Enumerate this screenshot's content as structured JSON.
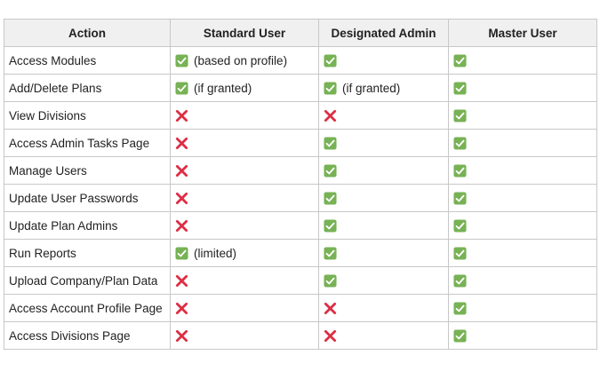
{
  "colors": {
    "header_bg": "#f0f0f0",
    "border": "#c8c8c8",
    "check_bg": "#77b255",
    "cross": "#dd2e44"
  },
  "icons": {
    "yes": "check-mark-button-icon",
    "no": "cross-mark-icon"
  },
  "table": {
    "headers": [
      "Action",
      "Standard User",
      "Designated Admin",
      "Master User"
    ],
    "rows": [
      {
        "action": "Access Modules",
        "cells": [
          {
            "mark": "yes",
            "note": "(based on profile)"
          },
          {
            "mark": "yes",
            "note": ""
          },
          {
            "mark": "yes",
            "note": ""
          }
        ]
      },
      {
        "action": "Add/Delete Plans",
        "cells": [
          {
            "mark": "yes",
            "note": "(if granted)"
          },
          {
            "mark": "yes",
            "note": "(if granted)"
          },
          {
            "mark": "yes",
            "note": ""
          }
        ]
      },
      {
        "action": "View Divisions",
        "cells": [
          {
            "mark": "no",
            "note": ""
          },
          {
            "mark": "no",
            "note": ""
          },
          {
            "mark": "yes",
            "note": ""
          }
        ]
      },
      {
        "action": "Access Admin Tasks Page",
        "cells": [
          {
            "mark": "no",
            "note": ""
          },
          {
            "mark": "yes",
            "note": ""
          },
          {
            "mark": "yes",
            "note": ""
          }
        ]
      },
      {
        "action": "Manage Users",
        "cells": [
          {
            "mark": "no",
            "note": ""
          },
          {
            "mark": "yes",
            "note": ""
          },
          {
            "mark": "yes",
            "note": ""
          }
        ]
      },
      {
        "action": "Update User Passwords",
        "cells": [
          {
            "mark": "no",
            "note": ""
          },
          {
            "mark": "yes",
            "note": ""
          },
          {
            "mark": "yes",
            "note": ""
          }
        ]
      },
      {
        "action": "Update Plan Admins",
        "cells": [
          {
            "mark": "no",
            "note": ""
          },
          {
            "mark": "yes",
            "note": ""
          },
          {
            "mark": "yes",
            "note": ""
          }
        ]
      },
      {
        "action": "Run Reports",
        "cells": [
          {
            "mark": "yes",
            "note": "(limited)"
          },
          {
            "mark": "yes",
            "note": ""
          },
          {
            "mark": "yes",
            "note": ""
          }
        ]
      },
      {
        "action": "Upload Company/Plan Data",
        "cells": [
          {
            "mark": "no",
            "note": ""
          },
          {
            "mark": "yes",
            "note": ""
          },
          {
            "mark": "yes",
            "note": ""
          }
        ]
      },
      {
        "action": "Access Account Profile Page",
        "cells": [
          {
            "mark": "no",
            "note": ""
          },
          {
            "mark": "no",
            "note": ""
          },
          {
            "mark": "yes",
            "note": ""
          }
        ]
      },
      {
        "action": "Access Divisions Page",
        "cells": [
          {
            "mark": "no",
            "note": ""
          },
          {
            "mark": "no",
            "note": ""
          },
          {
            "mark": "yes",
            "note": ""
          }
        ]
      }
    ]
  }
}
